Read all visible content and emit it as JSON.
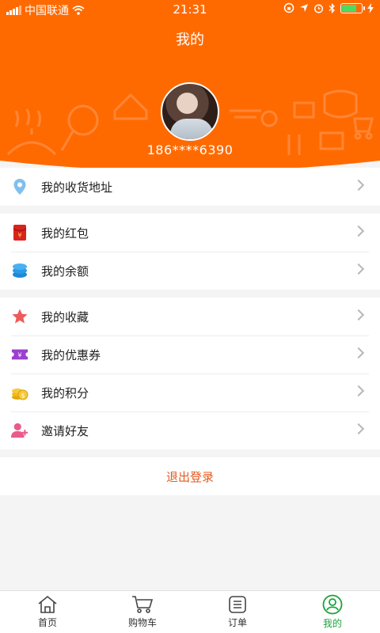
{
  "status_bar": {
    "carrier": "中国联通",
    "time": "21:31",
    "battery_percent": 75,
    "icons": [
      "signal-icon",
      "wifi-icon",
      "lock-rotation-icon",
      "location-icon",
      "alarm-icon",
      "bluetooth-icon",
      "battery-icon",
      "charging-icon"
    ]
  },
  "header": {
    "title": "我的",
    "phone": "186****6390",
    "background_color": "#ff6a00"
  },
  "address_group": {
    "items": [
      {
        "label": "我的收货地址",
        "icon": "location-pin-icon"
      }
    ]
  },
  "wallet_group": {
    "items": [
      {
        "label": "我的红包",
        "icon": "red-envelope-icon"
      },
      {
        "label": "我的余额",
        "icon": "coins-stack-icon"
      }
    ]
  },
  "more_group": {
    "items": [
      {
        "label": "我的收藏",
        "icon": "star-icon"
      },
      {
        "label": "我的优惠券",
        "icon": "coupon-icon"
      },
      {
        "label": "我的积分",
        "icon": "points-coins-icon"
      },
      {
        "label": "邀请好友",
        "icon": "add-friend-icon"
      }
    ]
  },
  "logout_label": "退出登录",
  "tabbar": {
    "tabs": [
      {
        "label": "首页",
        "icon": "home-icon"
      },
      {
        "label": "购物车",
        "icon": "cart-icon"
      },
      {
        "label": "订单",
        "icon": "order-list-icon"
      },
      {
        "label": "我的",
        "icon": "profile-icon"
      }
    ],
    "active_color": "#1ba33c"
  }
}
